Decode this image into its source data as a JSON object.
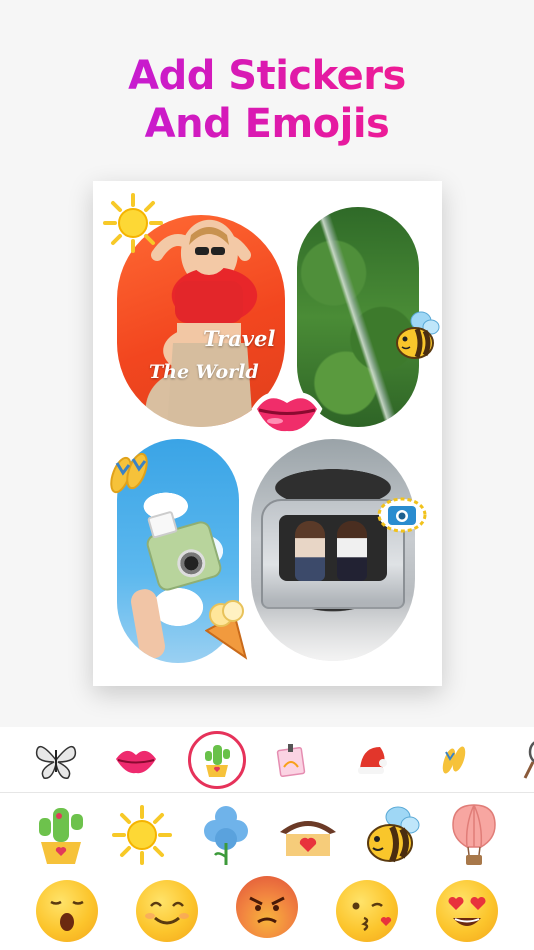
{
  "headline": {
    "line1": "Add Stickers",
    "line2": "And Emojis"
  },
  "collage": {
    "text_sticker": {
      "line1": "Travel",
      "line2": "The World"
    },
    "photos": [
      "portrait-photo",
      "forest-river-photo",
      "instant-camera-photo",
      "car-trunk-friends-photo"
    ],
    "stickers": [
      "sun-icon",
      "bee-icon",
      "lips-icon",
      "flip-flops-icon",
      "camera-icon",
      "ice-cream-icon"
    ]
  },
  "tray": {
    "tabs": [
      {
        "icon": "butterfly-icon"
      },
      {
        "icon": "lips-icon"
      },
      {
        "icon": "cactus-icon",
        "selected": true
      },
      {
        "icon": "photo-frame-icon"
      },
      {
        "icon": "santa-hat-icon"
      },
      {
        "icon": "flip-flops-icon"
      },
      {
        "icon": "tennis-racket-icon"
      }
    ],
    "stickers_row": [
      "cactus-icon",
      "sun-icon",
      "blue-tree-icon",
      "heart-house-icon",
      "bee-icon",
      "hot-air-balloon-icon"
    ],
    "emoji_row": [
      "shocked-face-icon",
      "smiling-face-icon",
      "angry-face-icon",
      "kissing-face-icon",
      "heart-eyes-face-icon"
    ]
  },
  "colors": {
    "headline_start": "#b21cf0",
    "headline_end": "#ff1d7c",
    "tab_selected": "#e6325a",
    "background": "#f6f6f6"
  }
}
